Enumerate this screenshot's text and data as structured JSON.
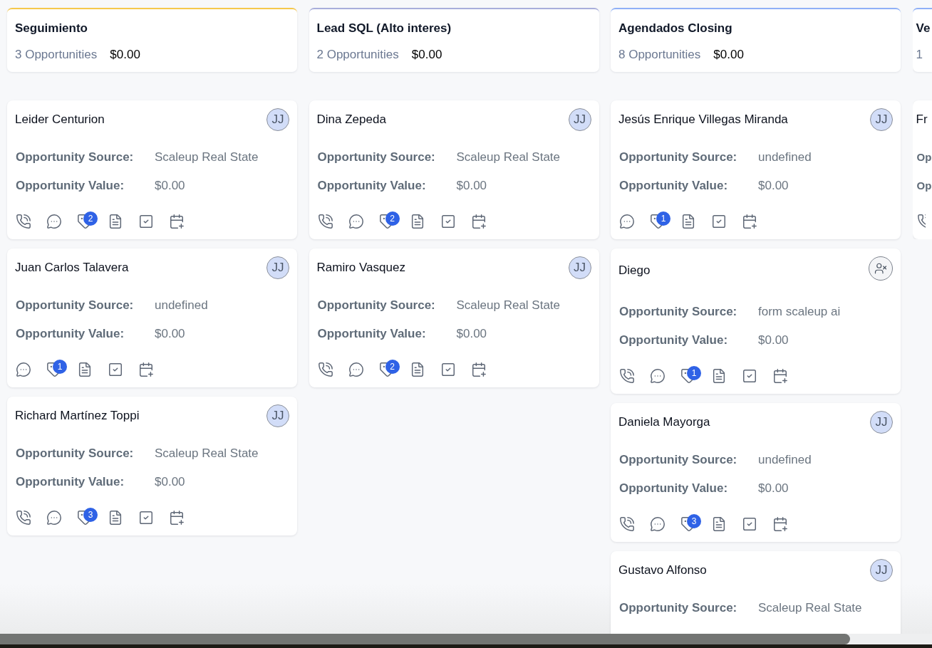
{
  "columns": [
    {
      "title": "Seguimiento",
      "count": "3 Opportunities",
      "total": "$0.00",
      "color": "#f5c84c",
      "cards": [
        {
          "name": "Leider Centurion",
          "owner": {
            "kind": "initials",
            "text": "JJ"
          },
          "fields": [
            {
              "label": "Opportunity Source:",
              "value": "Scaleup Real State"
            },
            {
              "label": "Opportunity Value:",
              "value": "$0.00"
            }
          ],
          "actions": [
            {
              "kind": "call"
            },
            {
              "kind": "message"
            },
            {
              "kind": "tag",
              "count": "2"
            },
            {
              "kind": "note"
            },
            {
              "kind": "task"
            },
            {
              "kind": "appointment"
            }
          ]
        },
        {
          "name": "Juan Carlos Talavera",
          "owner": {
            "kind": "initials",
            "text": "JJ"
          },
          "fields": [
            {
              "label": "Opportunity Source:",
              "value": "undefined"
            },
            {
              "label": "Opportunity Value:",
              "value": "$0.00"
            }
          ],
          "actions": [
            {
              "kind": "message"
            },
            {
              "kind": "tag",
              "count": "1"
            },
            {
              "kind": "note"
            },
            {
              "kind": "task"
            },
            {
              "kind": "appointment"
            }
          ]
        },
        {
          "name": "Richard Martínez Toppi",
          "owner": {
            "kind": "initials",
            "text": "JJ"
          },
          "fields": [
            {
              "label": "Opportunity Source:",
              "value": "Scaleup Real State"
            },
            {
              "label": "Opportunity Value:",
              "value": "$0.00"
            }
          ],
          "actions": [
            {
              "kind": "call"
            },
            {
              "kind": "message"
            },
            {
              "kind": "tag",
              "count": "3"
            },
            {
              "kind": "note"
            },
            {
              "kind": "task"
            },
            {
              "kind": "appointment"
            }
          ]
        }
      ]
    },
    {
      "title": "Lead SQL (Alto interes)",
      "count": "2 Opportunities",
      "total": "$0.00",
      "color": "#a9aedb",
      "cards": [
        {
          "name": "Dina Zepeda",
          "owner": {
            "kind": "initials",
            "text": "JJ"
          },
          "fields": [
            {
              "label": "Opportunity Source:",
              "value": "Scaleup Real State"
            },
            {
              "label": "Opportunity Value:",
              "value": "$0.00"
            }
          ],
          "actions": [
            {
              "kind": "call"
            },
            {
              "kind": "message"
            },
            {
              "kind": "tag",
              "count": "2"
            },
            {
              "kind": "note"
            },
            {
              "kind": "task"
            },
            {
              "kind": "appointment"
            }
          ]
        },
        {
          "name": "Ramiro Vasquez",
          "owner": {
            "kind": "initials",
            "text": "JJ"
          },
          "fields": [
            {
              "label": "Opportunity Source:",
              "value": "Scaleup Real State"
            },
            {
              "label": "Opportunity Value:",
              "value": "$0.00"
            }
          ],
          "actions": [
            {
              "kind": "call"
            },
            {
              "kind": "message"
            },
            {
              "kind": "tag",
              "count": "2"
            },
            {
              "kind": "note"
            },
            {
              "kind": "task"
            },
            {
              "kind": "appointment"
            }
          ]
        }
      ]
    },
    {
      "title": "Agendados Closing",
      "count": "8 Opportunities",
      "total": "$0.00",
      "color": "#8fb0f7",
      "cards": [
        {
          "name": "Jesús Enrique Villegas Miranda",
          "owner": {
            "kind": "initials",
            "text": "JJ"
          },
          "fields": [
            {
              "label": "Opportunity Source:",
              "value": "undefined"
            },
            {
              "label": "Opportunity Value:",
              "value": "$0.00"
            }
          ],
          "actions": [
            {
              "kind": "message"
            },
            {
              "kind": "tag",
              "count": "1"
            },
            {
              "kind": "note"
            },
            {
              "kind": "task"
            },
            {
              "kind": "appointment"
            }
          ]
        },
        {
          "name": "Diego",
          "owner": {
            "kind": "unassigned"
          },
          "fields": [
            {
              "label": "Opportunity Source:",
              "value": "form scaleup ai"
            },
            {
              "label": "Opportunity Value:",
              "value": "$0.00"
            }
          ],
          "actions": [
            {
              "kind": "call"
            },
            {
              "kind": "message"
            },
            {
              "kind": "tag",
              "count": "1"
            },
            {
              "kind": "note"
            },
            {
              "kind": "task"
            },
            {
              "kind": "appointment"
            }
          ]
        },
        {
          "name": "Daniela Mayorga",
          "owner": {
            "kind": "initials",
            "text": "JJ"
          },
          "fields": [
            {
              "label": "Opportunity Source:",
              "value": "undefined"
            },
            {
              "label": "Opportunity Value:",
              "value": "$0.00"
            }
          ],
          "actions": [
            {
              "kind": "call"
            },
            {
              "kind": "message"
            },
            {
              "kind": "tag",
              "count": "3"
            },
            {
              "kind": "note"
            },
            {
              "kind": "task"
            },
            {
              "kind": "appointment"
            }
          ]
        },
        {
          "name": "Gustavo Alfonso",
          "owner": {
            "kind": "initials",
            "text": "JJ"
          },
          "fields": [
            {
              "label": "Opportunity Source:",
              "value": "Scaleup Real State"
            }
          ]
        }
      ]
    },
    {
      "title": "Ve",
      "count": "1",
      "color": "#8fb0f7",
      "cards": [
        {
          "name": "Fr",
          "fields": [
            {
              "label": "Op"
            },
            {
              "label": "Op"
            }
          ],
          "actions": [
            {
              "kind": "call"
            }
          ]
        }
      ]
    }
  ]
}
